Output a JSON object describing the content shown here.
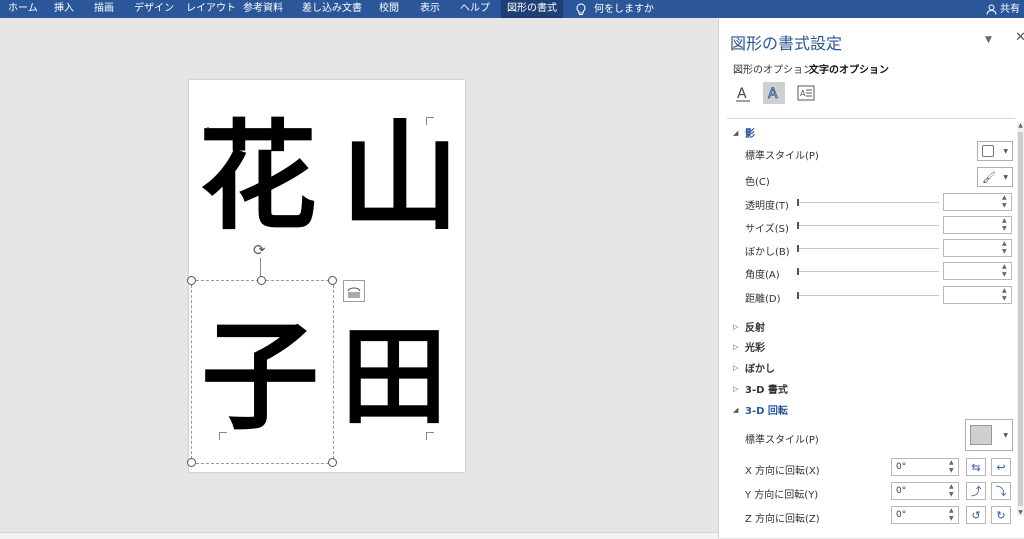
{
  "ribbon": {
    "tabs": [
      "ホーム",
      "挿入",
      "描画",
      "デザイン",
      "レイアウト",
      "参考資料",
      "差し込み文書",
      "校閲",
      "表示",
      "ヘルプ",
      "図形の書式"
    ],
    "tell_me": "何をしますか",
    "share": "共有"
  },
  "document": {
    "chars": [
      "花",
      "山",
      "子",
      "田"
    ]
  },
  "pane": {
    "title": "図形の書式設定",
    "tab_shape": "図形のオプション",
    "tab_text": "文字のオプション",
    "shadow": {
      "header": "影",
      "preset_label": "標準スタイル(P)",
      "color_label": "色(C)",
      "transparency_label": "透明度(T)",
      "size_label": "サイズ(S)",
      "blur_label": "ぼかし(B)",
      "angle_label": "角度(A)",
      "distance_label": "距離(D)"
    },
    "reflection": "反射",
    "glow": "光彩",
    "soft_edges": "ぼかし",
    "format3d": "3-D 書式",
    "rotation3d": {
      "header": "3-D 回転",
      "preset_label": "標準スタイル(P)",
      "x_label": "X 方向に回転(X)",
      "x_value": "0°",
      "y_label": "Y 方向に回転(Y)",
      "y_value": "0°",
      "z_label": "Z 方向に回転(Z)",
      "z_value": "0°"
    }
  },
  "colors": {
    "ribbon": "#2b579a",
    "accent": "#2b579a"
  }
}
